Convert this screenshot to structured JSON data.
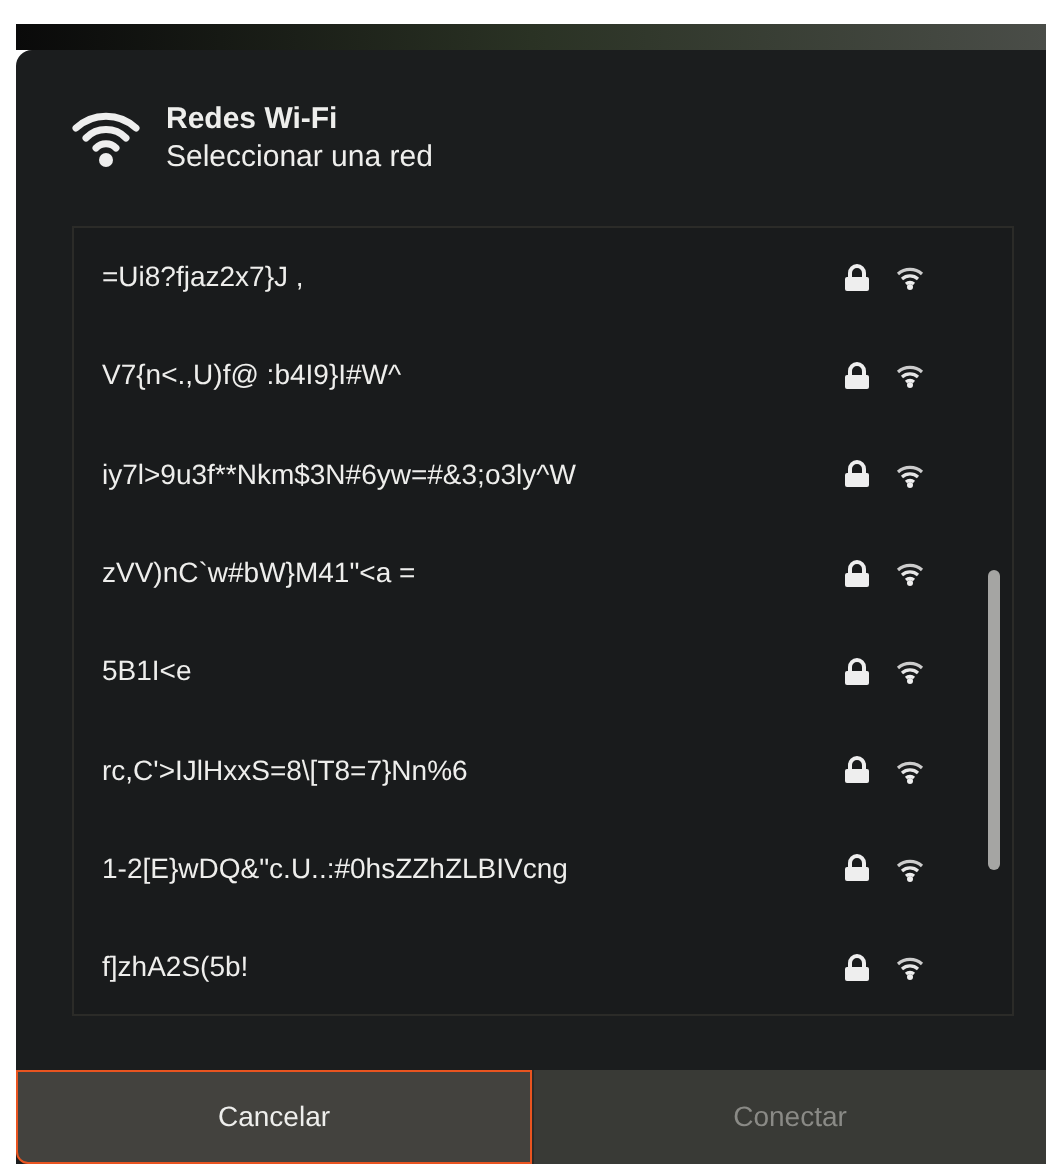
{
  "dialog": {
    "title": "Redes Wi-Fi",
    "subtitle": "Seleccionar una red"
  },
  "networks": [
    {
      "name": "=Ui8?fjaz2x7}J ,",
      "secured": true
    },
    {
      "name": "V7{n<.,U)f@ :b4I9}I#W^",
      "secured": true
    },
    {
      "name": "iy7l>9u3f**Nkm$3N#6yw=#&3;o3ly^W",
      "secured": true
    },
    {
      "name": "zVV)nC`w#bW}M41\"<a =",
      "secured": true
    },
    {
      "name": "5B1I<e",
      "secured": true
    },
    {
      "name": "rc,C'>IJlHxxS=8\\[T8=7}Nn%6",
      "secured": true
    },
    {
      "name": "1-2[E}wDQ&\"c.U..:#0hsZZhZLBIVcng",
      "secured": true
    },
    {
      "name": "f]zhA2S(5b!",
      "secured": true
    }
  ],
  "buttons": [
    {
      "label": "Cancelar",
      "focused": true,
      "disabled": false
    },
    {
      "label": "Conectar",
      "focused": false,
      "disabled": true
    }
  ]
}
